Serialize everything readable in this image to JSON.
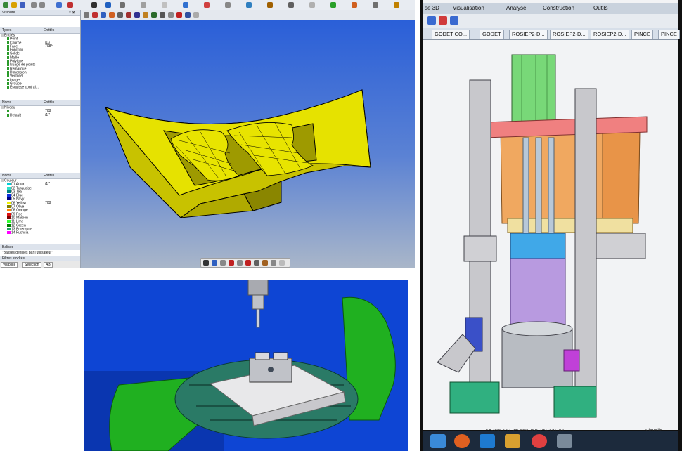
{
  "window1": {
    "visibility_title": "Visibilité",
    "panel1": {
      "col_types": "Types",
      "col_entities": "Entités",
      "items": [
        {
          "label": "Entités",
          "count": ""
        },
        {
          "label": "Point",
          "count": ""
        },
        {
          "label": "Courbe",
          "count": "/13"
        },
        {
          "label": "Face",
          "count": "708/4"
        },
        {
          "label": "Fonction",
          "count": ""
        },
        {
          "label": "Solide",
          "count": ""
        },
        {
          "label": "Maille",
          "count": ""
        },
        {
          "label": "Polylgne",
          "count": ""
        },
        {
          "label": "Nuage de points",
          "count": ""
        },
        {
          "label": "Remarque",
          "count": ""
        },
        {
          "label": "Dimension",
          "count": ""
        },
        {
          "label": "Vectoriel",
          "count": ""
        },
        {
          "label": "Image",
          "count": ""
        },
        {
          "label": "Groupe",
          "count": ""
        },
        {
          "label": "Esquisse contrai...",
          "count": ""
        }
      ]
    },
    "panel2": {
      "col_names": "Noms",
      "col_entities": "Entités",
      "items": [
        {
          "label": "Niveau",
          "count": ""
        },
        {
          "label": "1",
          "count": "708"
        },
        {
          "label": "Default",
          "count": "/17"
        }
      ]
    },
    "panel3": {
      "col_names": "Noms",
      "col_entities": "Entités",
      "items": [
        {
          "label": "Couleur",
          "count": "",
          "color": ""
        },
        {
          "label": "01 Aqua",
          "count": "/17",
          "color": "#00d0d8"
        },
        {
          "label": "02 Turquoise",
          "count": "",
          "color": "#30e0c8"
        },
        {
          "label": "03 Teal",
          "count": "",
          "color": "#008080"
        },
        {
          "label": "04 Blue",
          "count": "",
          "color": "#1030e0"
        },
        {
          "label": "05 Navy",
          "count": "",
          "color": "#000080"
        },
        {
          "label": "06 Yellow",
          "count": "708",
          "color": "#f0f000"
        },
        {
          "label": "07 Olive",
          "count": "",
          "color": "#808000"
        },
        {
          "label": "08 Orange",
          "count": "",
          "color": "#ff8800"
        },
        {
          "label": "09 Red",
          "count": "",
          "color": "#e01010"
        },
        {
          "label": "10 Maroon",
          "count": "",
          "color": "#800000"
        },
        {
          "label": "11 Lime",
          "count": "",
          "color": "#30ff30"
        },
        {
          "label": "12 Green",
          "count": "",
          "color": "#008000"
        },
        {
          "label": "13 Emeraude",
          "count": "",
          "color": "#20a060"
        },
        {
          "label": "14 Fuchsia",
          "count": "",
          "color": "#ff00ff"
        }
      ]
    },
    "balises": "Balises",
    "balises_user": "\"Balises définies par l'utilisateur\"",
    "filtres": "Filtres stockés",
    "tab_visibilite": "Visibilité",
    "tab_selection": "Sélection",
    "tab_ab": "AB"
  },
  "window2": {
    "menu": [
      "se 3D",
      "Visualisation",
      "Analyse",
      "Construction",
      "Outils"
    ],
    "doc_tabs": [
      "GODET CO...",
      "GODET",
      "ROSIEP2-D...",
      "ROSIEP2-D...",
      "ROSIEP2-D...",
      "PINCE",
      "PINCE"
    ],
    "coords": "X=-216.167   Y=-658.768   Z=+000.000",
    "status_right": "Visualis"
  }
}
